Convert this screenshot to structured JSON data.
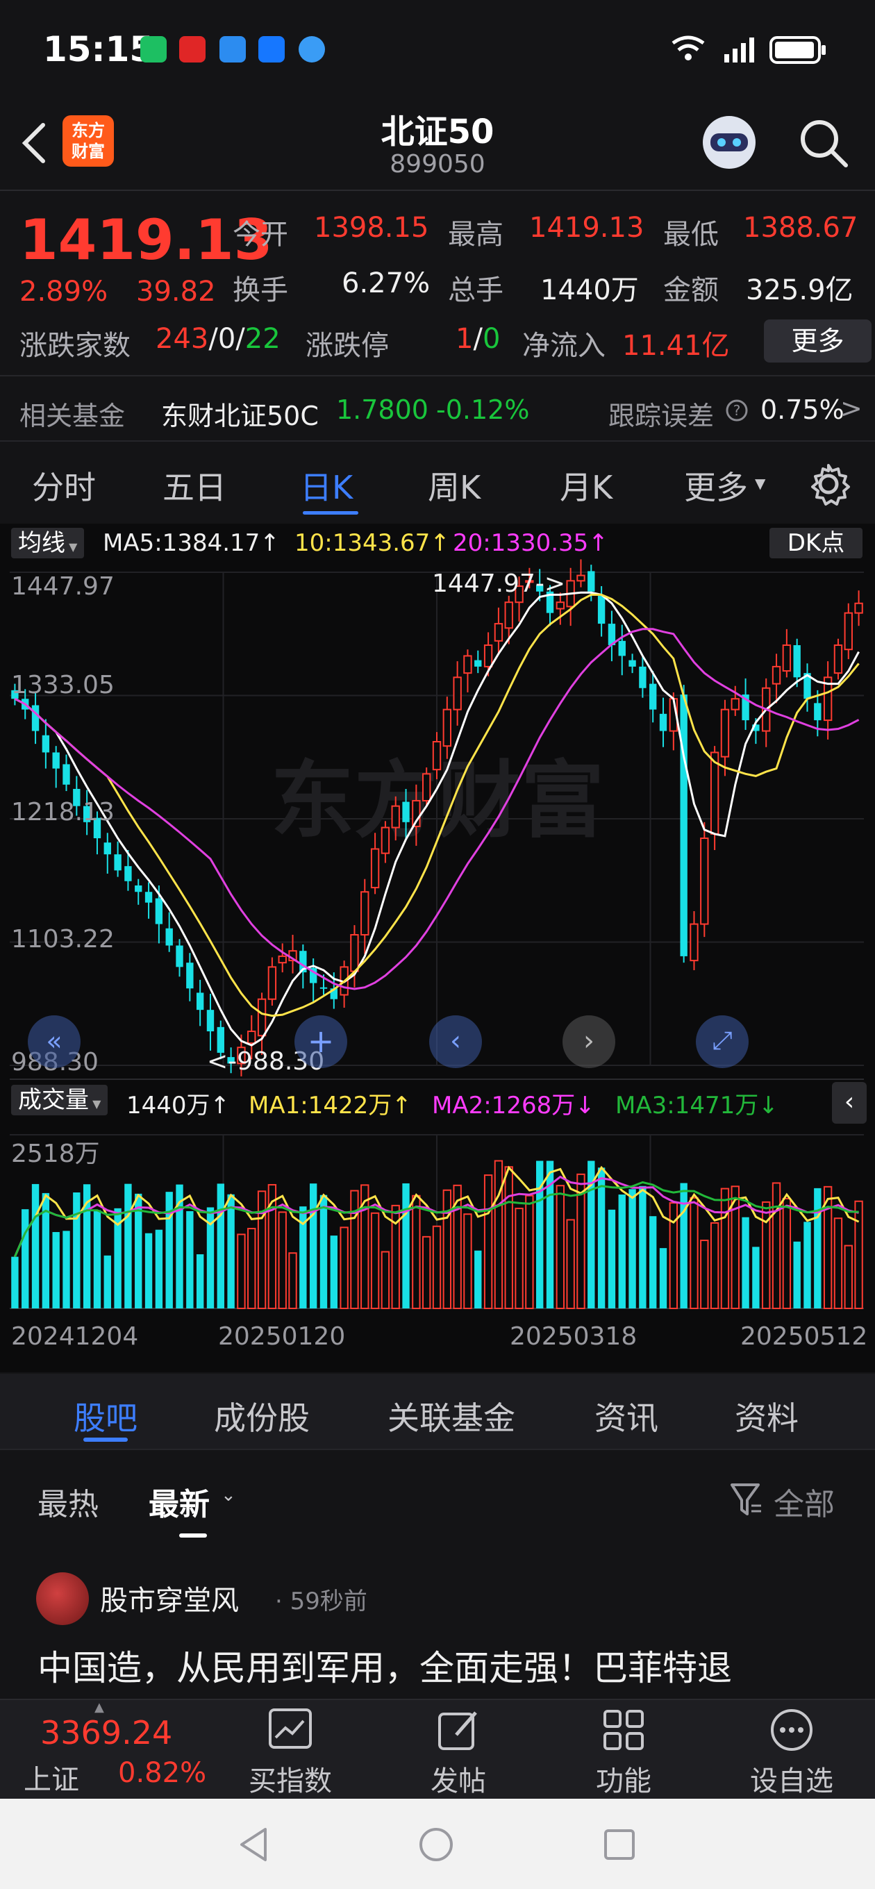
{
  "status": {
    "time": "15:15"
  },
  "header": {
    "title": "北证50",
    "code": "899050",
    "logo_line1": "东方",
    "logo_line2": "财富"
  },
  "quote": {
    "price": "1419.13",
    "change_pct": "2.89%",
    "change": "39.82",
    "open_label": "今开",
    "open": "1398.15",
    "high_label": "最高",
    "high": "1419.13",
    "low_label": "最低",
    "low": "1388.67",
    "turnover_label": "换手",
    "turnover": "6.27%",
    "total_hands_label": "总手",
    "total_hands": "1440万",
    "amount_label": "金额",
    "amount": "325.9亿",
    "breadth_label": "涨跌家数",
    "breadth_up": "243",
    "breadth_sep1": "/",
    "breadth_flat": "0",
    "breadth_sep2": "/",
    "breadth_down": "22",
    "limit_label": "涨跌停",
    "limit_up": "1",
    "limit_sep": "/",
    "limit_down": "0",
    "netflow_label": "净流入",
    "netflow": "11.41亿",
    "more_label": "更多"
  },
  "fund": {
    "label": "相关基金",
    "name": "东财北证50C",
    "price": "1.7800",
    "change": "-0.12%",
    "err_label": "跟踪误差",
    "err_value": "0.75%",
    "arrow": ">"
  },
  "tabs": [
    {
      "label": "分时"
    },
    {
      "label": "五日"
    },
    {
      "label": "日K"
    },
    {
      "label": "周K"
    },
    {
      "label": "月K"
    },
    {
      "label": "更多"
    }
  ],
  "chart_data": {
    "type": "candlestick",
    "ma_selector": "均线",
    "ma5": "MA5:1384.17↑",
    "ma10": "10:1343.67↑",
    "ma20": "20:1330.35↑",
    "dk_label": "DK点",
    "y_ticks": [
      "1447.97",
      "1333.05",
      "1218.13",
      "1103.22",
      "988.30"
    ],
    "ylim": [
      988.3,
      1447.97
    ],
    "max_annotation": "1447.97->",
    "min_annotation": "<-988.30",
    "volume_selector": "成交量",
    "volume_now": "1440万↑",
    "vol_ma1": "MA1:1422万↑",
    "vol_ma2": "MA2:1268万↓",
    "vol_ma3": "MA3:1471万↓",
    "volume_top": "2518万",
    "x_ticks": [
      "20241204",
      "20250120",
      "20250318",
      "20250512"
    ],
    "colors": {
      "up": "#ff3b30",
      "down": "#19e0e6",
      "ma5": "#ffffff",
      "ma10": "#ffe44a",
      "ma20": "#e040e0",
      "vma3": "#22b83a"
    },
    "close_series": [
      1330,
      1320,
      1300,
      1280,
      1265,
      1250,
      1230,
      1215,
      1200,
      1185,
      1170,
      1160,
      1150,
      1140,
      1120,
      1100,
      1080,
      1060,
      1040,
      1020,
      1000,
      990,
      1005,
      1020,
      1050,
      1080,
      1090,
      1095,
      1075,
      1065,
      1060,
      1050,
      1080,
      1110,
      1150,
      1190,
      1210,
      1230,
      1215,
      1235,
      1260,
      1290,
      1320,
      1350,
      1370,
      1360,
      1380,
      1400,
      1420,
      1435,
      1440,
      1430,
      1410,
      1420,
      1440,
      1445,
      1430,
      1400,
      1380,
      1370,
      1360,
      1340,
      1320,
      1300,
      1330,
      1090,
      1120,
      1200,
      1280,
      1320,
      1330,
      1310,
      1300,
      1340,
      1360,
      1380,
      1350,
      1330,
      1310,
      1350,
      1380,
      1410,
      1419
    ]
  },
  "news_tabs": [
    {
      "label": "股吧"
    },
    {
      "label": "成份股"
    },
    {
      "label": "关联基金"
    },
    {
      "label": "资讯"
    },
    {
      "label": "资料"
    }
  ],
  "filters": {
    "hot": "最热",
    "latest": "最新",
    "all": "全部"
  },
  "post": {
    "author": "股市穿堂风",
    "time": "· 59秒前",
    "text": "中国造，从民用到军用，全面走强！巴菲特退"
  },
  "toolbar": {
    "index_price": "3369.24",
    "index_name": "上证",
    "index_pct": "0.82%",
    "items": [
      {
        "label": "买指数"
      },
      {
        "label": "发帖"
      },
      {
        "label": "功能"
      },
      {
        "label": "设自选"
      }
    ]
  }
}
